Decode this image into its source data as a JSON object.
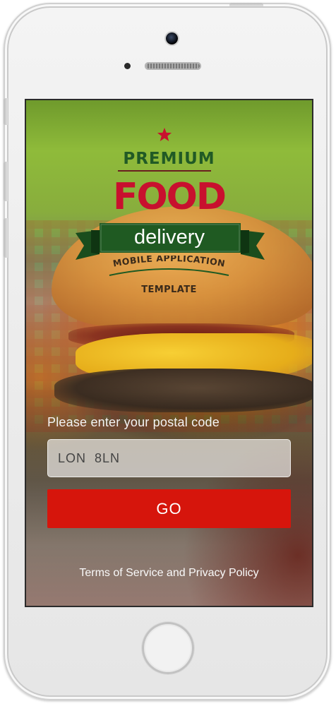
{
  "device": {
    "name": "iPhone mockup"
  },
  "branding": {
    "star_icon": "star-icon",
    "premium": "PREMIUM",
    "food": "FOOD",
    "delivery": "delivery",
    "subtitle_line1": "MOBILE APPLICATION",
    "subtitle_line2": "TEMPLATE",
    "colors": {
      "green": "#215a25",
      "red": "#c8102e",
      "ribbon": "#1f5a22"
    }
  },
  "form": {
    "prompt": "Please enter your postal code",
    "postal_code_value": "LON  8LN",
    "go_label": "GO",
    "go_color": "#d6150c"
  },
  "footer": {
    "terms": "Terms of Service and Privacy Policy"
  }
}
